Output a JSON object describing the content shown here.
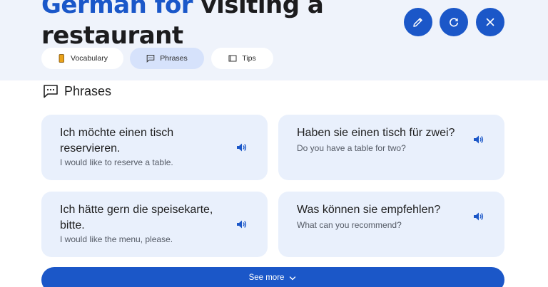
{
  "header": {
    "title_accent": "German for",
    "title_rest": "visiting a restaurant",
    "buttons": [
      "edit",
      "refresh",
      "close"
    ]
  },
  "tabs": [
    {
      "label": "Vocabulary",
      "icon": "book-icon",
      "active": false
    },
    {
      "label": "Phrases",
      "icon": "chat-icon",
      "active": true
    },
    {
      "label": "Tips",
      "icon": "tips-icon",
      "active": false
    }
  ],
  "section": {
    "title": "Phrases",
    "icon": "chat-bubble-icon"
  },
  "phrases": [
    {
      "phrase": "Ich möchte einen tisch reservieren.",
      "translation": "I would like to reserve a table."
    },
    {
      "phrase": "Haben sie einen tisch für zwei?",
      "translation": "Do you have a table for two?"
    },
    {
      "phrase": "Ich hätte gern die speisekarte, bitte.",
      "translation": "I would like the menu, please."
    },
    {
      "phrase": "Was können sie empfehlen?",
      "translation": "What can you recommend?"
    }
  ],
  "see_more": {
    "label": "See more"
  },
  "colors": {
    "accent": "#1b57c8",
    "header_bg": "#eff3fb",
    "card_bg": "#e9f0fc",
    "tab_active": "#d6e2fb"
  }
}
